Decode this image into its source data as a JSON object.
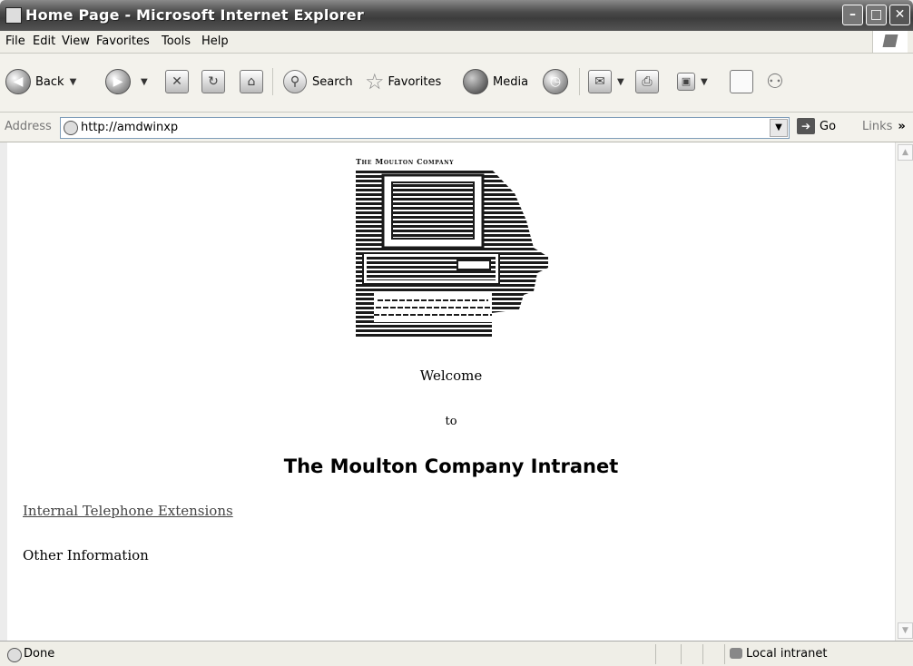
{
  "window": {
    "title": "Home Page - Microsoft Internet Explorer"
  },
  "menu": [
    "File",
    "Edit",
    "View",
    "Favorites",
    "Tools",
    "Help"
  ],
  "toolbar": {
    "back": "Back",
    "search": "Search",
    "favorites": "Favorites",
    "media": "Media"
  },
  "address": {
    "label": "Address",
    "url": "http://amdwinxp",
    "go": "Go",
    "links": "Links",
    "links_more": "»"
  },
  "page": {
    "logo_text": "The Moulton Company",
    "welcome": "Welcome",
    "to": "to",
    "heading": "The Moulton Company Intranet",
    "link_phone": "Internal Telephone Extensions",
    "other_info": "Other Information"
  },
  "status": {
    "text": "Done",
    "zone": "Local intranet"
  },
  "icons": [
    "ie-page-icon",
    "back-icon",
    "forward-icon",
    "stop-icon",
    "refresh-icon",
    "home-icon",
    "search-icon",
    "favorites-icon",
    "media-icon",
    "history-icon",
    "mail-icon",
    "print-icon",
    "edit-icon",
    "discuss-icon",
    "messenger-icon",
    "go-icon",
    "local-intranet-icon"
  ]
}
